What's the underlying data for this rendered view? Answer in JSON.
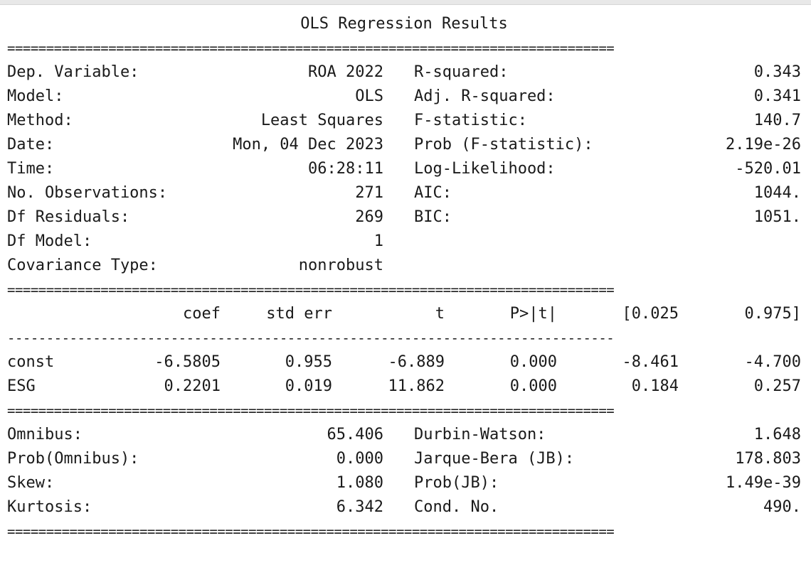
{
  "title": "OLS Regression Results",
  "separator_double": "==============================================================================",
  "separator_single": "------------------------------------------------------------------------------",
  "summary_rows": [
    {
      "l_label": "Dep. Variable:",
      "l_value": "ROA 2022",
      "r_label": "R-squared:",
      "r_value": "0.343"
    },
    {
      "l_label": "Model:",
      "l_value": "OLS",
      "r_label": "Adj. R-squared:",
      "r_value": "0.341"
    },
    {
      "l_label": "Method:",
      "l_value": "Least Squares",
      "r_label": "F-statistic:",
      "r_value": "140.7"
    },
    {
      "l_label": "Date:",
      "l_value": "Mon, 04 Dec 2023",
      "r_label": "Prob (F-statistic):",
      "r_value": "2.19e-26"
    },
    {
      "l_label": "Time:",
      "l_value": "06:28:11",
      "r_label": "Log-Likelihood:",
      "r_value": "-520.01"
    },
    {
      "l_label": "No. Observations:",
      "l_value": "271",
      "r_label": "AIC:",
      "r_value": "1044."
    },
    {
      "l_label": "Df Residuals:",
      "l_value": "269",
      "r_label": "BIC:",
      "r_value": "1051."
    },
    {
      "l_label": "Df Model:",
      "l_value": "1",
      "r_label": "",
      "r_value": ""
    },
    {
      "l_label": "Covariance Type:",
      "l_value": "nonrobust",
      "r_label": "",
      "r_value": ""
    }
  ],
  "coef_table": {
    "headers": [
      "",
      "coef",
      "std err",
      "t",
      "P>|t|",
      "[0.025",
      "0.975]"
    ],
    "rows": [
      [
        "const",
        "-6.5805",
        "0.955",
        "-6.889",
        "0.000",
        "-8.461",
        "-4.700"
      ],
      [
        "ESG",
        "0.2201",
        "0.019",
        "11.862",
        "0.000",
        "0.184",
        "0.257"
      ]
    ]
  },
  "diagnostics_rows": [
    {
      "l_label": "Omnibus:",
      "l_value": "65.406",
      "r_label": "Durbin-Watson:",
      "r_value": "1.648"
    },
    {
      "l_label": "Prob(Omnibus):",
      "l_value": "0.000",
      "r_label": "Jarque-Bera (JB):",
      "r_value": "178.803"
    },
    {
      "l_label": "Skew:",
      "l_value": "1.080",
      "r_label": "Prob(JB):",
      "r_value": "1.49e-39"
    },
    {
      "l_label": "Kurtosis:",
      "l_value": "6.342",
      "r_label": "Cond. No.",
      "r_value": "490."
    }
  ]
}
